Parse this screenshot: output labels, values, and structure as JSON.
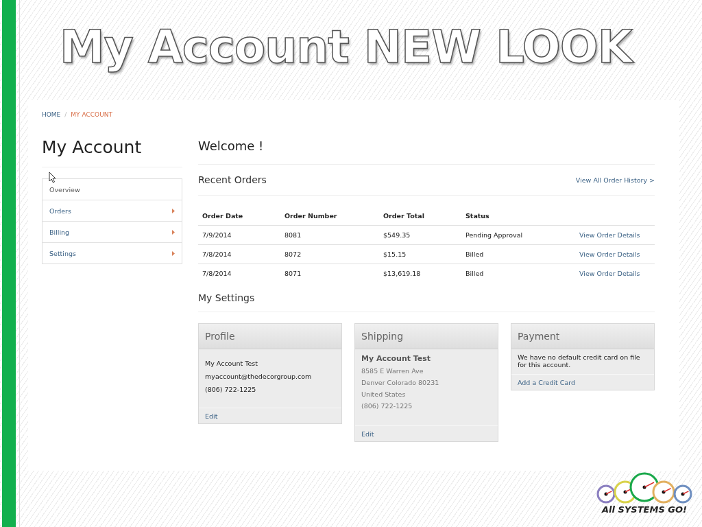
{
  "slide": {
    "title": "My Account NEW LOOK",
    "logo_text": "All SYSTEMS GO!"
  },
  "breadcrumb": {
    "separator": "/",
    "items": [
      {
        "label": "HOME",
        "selected": false
      },
      {
        "label": "MY ACCOUNT",
        "selected": true
      }
    ]
  },
  "sidebar": {
    "title": "My Account",
    "items": [
      {
        "label": "Overview",
        "selected": true,
        "has_submenu": false
      },
      {
        "label": "Orders",
        "selected": false,
        "has_submenu": true
      },
      {
        "label": "Billing",
        "selected": false,
        "has_submenu": true
      },
      {
        "label": "Settings",
        "selected": false,
        "has_submenu": true
      }
    ]
  },
  "welcome": "Welcome !",
  "recent_orders": {
    "title": "Recent Orders",
    "link": "View All Order History >",
    "columns": [
      "Order Date",
      "Order Number",
      "Order Total",
      "Status"
    ],
    "rows": [
      {
        "cells": [
          "7/9/2014",
          "8081",
          "$549.35",
          "Pending Approval"
        ],
        "link": "View Order Details"
      },
      {
        "cells": [
          "7/8/2014",
          "8072",
          "$15.15",
          "Billed"
        ],
        "link": "View Order Details"
      },
      {
        "cells": [
          "7/8/2014",
          "8071",
          "$13,619.18",
          "Billed"
        ],
        "link": "View Order Details"
      }
    ]
  },
  "settings": {
    "title": "My Settings",
    "cards": [
      {
        "kind": "lines",
        "title": "Profile",
        "lines": [
          "My Account Test",
          "myaccount@thedecorgroup.com",
          "(806) 722-1225"
        ],
        "action": "Edit"
      },
      {
        "kind": "address",
        "title": "Shipping",
        "name": "My Account Test",
        "lines": [
          "8585 E Warren Ave",
          "Denver Colorado 80231",
          "United States",
          "(806) 722-1225"
        ],
        "action": "Edit"
      },
      {
        "kind": "note",
        "title": "Payment",
        "text": "We have no default credit card on file for this account.",
        "action": "Add a Credit Card"
      }
    ]
  }
}
